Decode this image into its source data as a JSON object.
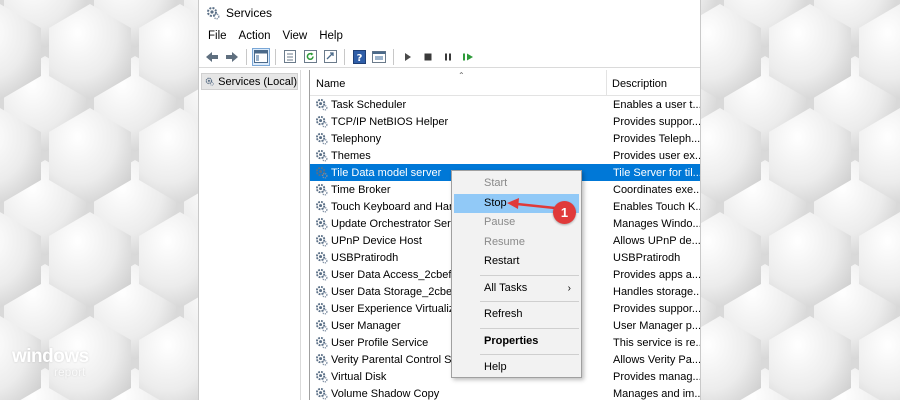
{
  "window": {
    "title": "Services",
    "menu": [
      "File",
      "Action",
      "View",
      "Help"
    ]
  },
  "toolbar": {
    "icons": [
      "back-arrow-icon",
      "forward-arrow-icon",
      "console-tree-icon",
      "properties-icon",
      "refresh-icon",
      "export-icon",
      "help-icon",
      "view-icon",
      "play-icon",
      "stop-icon",
      "pause-icon",
      "restart-icon"
    ]
  },
  "tree": {
    "root_label": "Services (Local)"
  },
  "list": {
    "columns": {
      "name": "Name",
      "description": "Description"
    },
    "rows": [
      {
        "name": "Task Scheduler",
        "description": "Enables a user t..."
      },
      {
        "name": "TCP/IP NetBIOS Helper",
        "description": "Provides suppor..."
      },
      {
        "name": "Telephony",
        "description": "Provides Teleph..."
      },
      {
        "name": "Themes",
        "description": "Provides user ex..."
      },
      {
        "name": "Tile Data model server",
        "description": "Tile Server for til..."
      },
      {
        "name": "Time Broker",
        "description": "Coordinates exe..."
      },
      {
        "name": "Touch Keyboard and Han",
        "description": "Enables Touch K..."
      },
      {
        "name": "Update Orchestrator Servi",
        "description": "Manages Windo..."
      },
      {
        "name": "UPnP Device Host",
        "description": "Allows UPnP de..."
      },
      {
        "name": "USBPratirodh",
        "description": "USBPratirodh"
      },
      {
        "name": "User Data Access_2cbef0e",
        "description": "Provides apps a..."
      },
      {
        "name": "User Data Storage_2cbef0",
        "description": "Handles storage..."
      },
      {
        "name": "User Experience Virtualiza",
        "description": "Provides suppor..."
      },
      {
        "name": "User Manager",
        "description": "User Manager p..."
      },
      {
        "name": "User Profile Service",
        "description": "This service is re..."
      },
      {
        "name": "Verity Parental Control So",
        "description": "Allows Verity Pa..."
      },
      {
        "name": "Virtual Disk",
        "description": "Provides manag..."
      },
      {
        "name": "Volume Shadow Copy",
        "description": "Manages and im..."
      }
    ],
    "selected_index": 4
  },
  "context_menu": {
    "start": "Start",
    "stop": "Stop",
    "pause": "Pause",
    "resume": "Resume",
    "restart": "Restart",
    "all_tasks": "All Tasks",
    "refresh": "Refresh",
    "properties": "Properties",
    "help": "Help"
  },
  "callout": {
    "number": "1"
  },
  "watermark": {
    "main": "windows",
    "sub": "report"
  },
  "colors": {
    "selection": "#0078d7",
    "menu_highlight": "#91c9f7",
    "callout": "#e03a3a"
  }
}
